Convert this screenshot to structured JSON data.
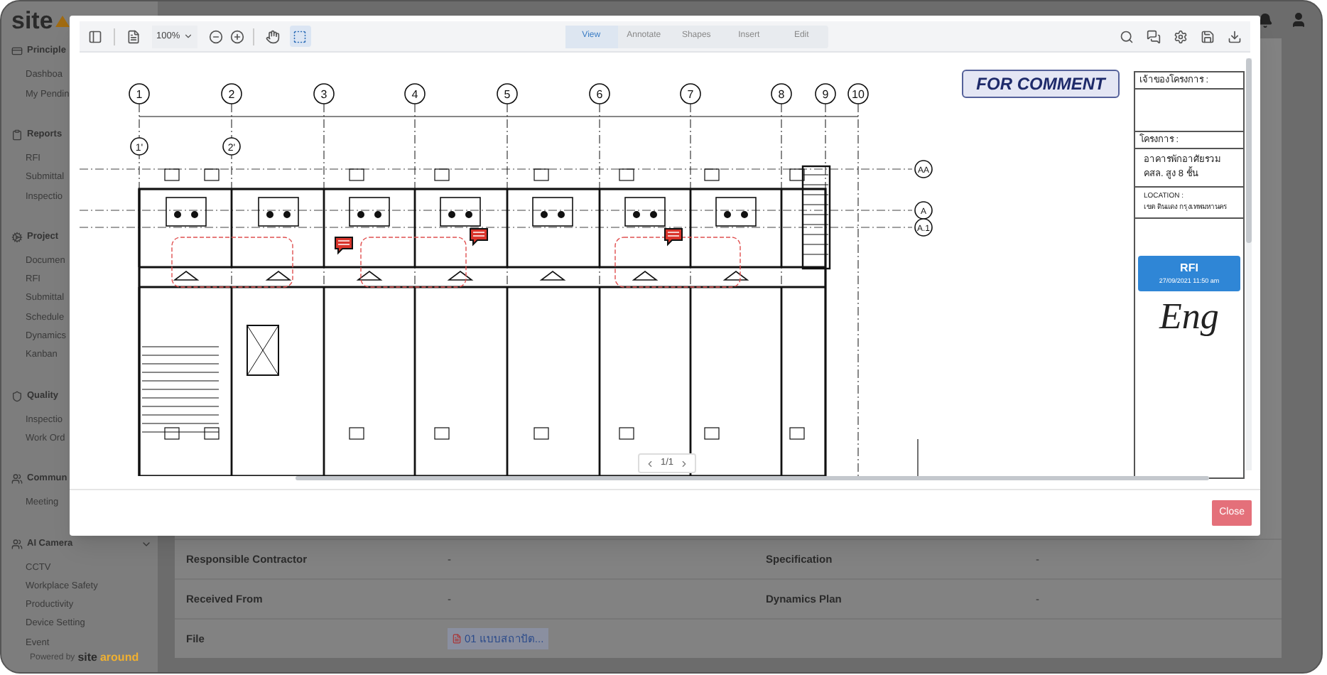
{
  "app": {
    "logo": "site",
    "sidebar": {
      "groups": [
        {
          "kind": "card",
          "title": "Principle",
          "items": [
            "Dashboa",
            "My Pendin"
          ]
        },
        {
          "kind": "clipboard",
          "title": "Reports",
          "items": [
            "RFI",
            "Submittal",
            "Inspectio"
          ]
        },
        {
          "kind": "cog",
          "title": "Project",
          "items": [
            "Documen",
            "RFI",
            "Submittal",
            "Schedule",
            "Dynamics",
            "Kanban"
          ]
        },
        {
          "kind": "shield",
          "title": "Quality",
          "items": [
            "Inspectio",
            "Work Ord"
          ]
        },
        {
          "kind": "people",
          "title": "Commun",
          "items": [
            "Meeting"
          ]
        },
        {
          "kind": "people",
          "title": "AI Camera",
          "expanded": true,
          "items": [
            "CCTV",
            "Workplace Safety",
            "Productivity",
            "Device Setting",
            "Event"
          ]
        }
      ],
      "footer": {
        "prefix": "Powered by",
        "brand": "site",
        "brand_accent": "around"
      }
    },
    "details": [
      {
        "label": "Responsible Contractor",
        "value": "-",
        "label_2": "Specification",
        "value_2": "-"
      },
      {
        "label": "Received From",
        "value": "-",
        "label_2": "Dynamics Plan",
        "value_2": "-"
      },
      {
        "label": "File",
        "file": "01 แบบสถาปัต..."
      }
    ]
  },
  "viewer": {
    "zoom": "100%",
    "tools": [
      {
        "kind": "pan",
        "selected": false
      },
      {
        "kind": "select",
        "selected": true
      }
    ],
    "tabs": [
      {
        "label": "View",
        "selected": true
      },
      {
        "label": "Annotate",
        "selected": false
      },
      {
        "label": "Shapes",
        "selected": false
      },
      {
        "label": "Insert",
        "selected": false
      },
      {
        "label": "Edit",
        "selected": false
      }
    ],
    "page": "1/1",
    "document": {
      "grid_columns": [
        "1",
        "2",
        "3",
        "4",
        "5",
        "6",
        "7",
        "8",
        "9",
        "10"
      ],
      "secondary_grid": [
        "1'",
        "2'"
      ],
      "grid_rows": [
        "AA",
        "A",
        "A.1"
      ],
      "stamp": "FOR COMMENT",
      "title_block": {
        "owner_label": "เจ้าของโครงการ :",
        "project_label": "โครงการ :",
        "project_lines": [
          "อาคารพักอาศัยรวม",
          "คสล. สูง 8 ชั้น"
        ],
        "location_label": "LOCATION :",
        "location": "เขต ดินแดง กรุงเทพมหานคร"
      },
      "rfi_stamp": {
        "title": "RFI",
        "date": "27/09/2021 11:50 am"
      },
      "signature": "Eng"
    },
    "close": "Close"
  }
}
